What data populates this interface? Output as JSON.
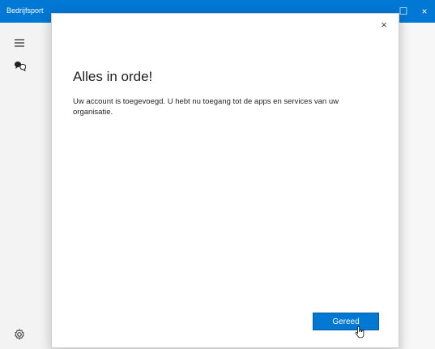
{
  "app": {
    "title": "Bedrijfsport",
    "window_controls": {
      "maximize": "☐",
      "close": "×"
    }
  },
  "sidebar": {
    "items": [
      {
        "icon": "hamburger-menu-icon"
      },
      {
        "icon": "chat-bubbles-icon"
      },
      {
        "icon": "settings-gear-icon"
      }
    ]
  },
  "dialog": {
    "close_symbol": "×",
    "title": "Alles in orde!",
    "message": "Uw account is toegevoegd. U hebt nu toegang tot de apps en services van uw organisatie.",
    "primary_button": "Gereed"
  },
  "colors": {
    "accent": "#0078d4",
    "background": "#f3f3f3",
    "dialog": "#ffffff"
  }
}
